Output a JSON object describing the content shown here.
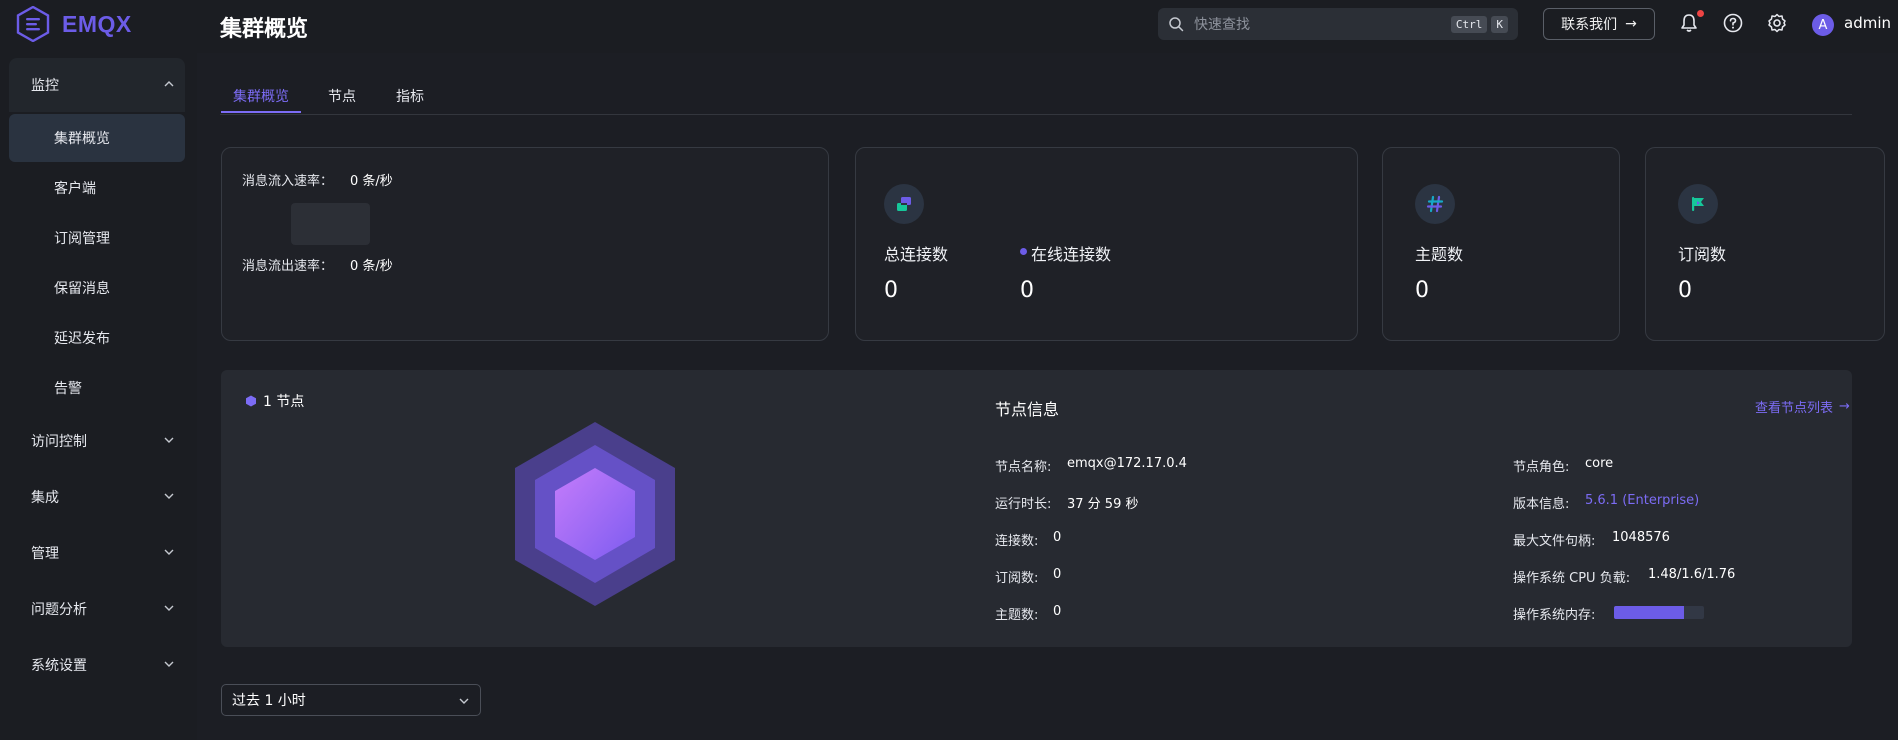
{
  "app": {
    "logo_text": "EMQX",
    "page_title": "集群概览"
  },
  "header": {
    "search_placeholder": "快速查找",
    "kbd_ctrl": "Ctrl",
    "kbd_k": "K",
    "contact_label": "联系我们",
    "username": "admin",
    "avatar_letter": "A"
  },
  "sidebar": {
    "groups": [
      {
        "label": "监控",
        "expanded": true
      },
      {
        "label": "访问控制",
        "expanded": false
      },
      {
        "label": "集成",
        "expanded": false
      },
      {
        "label": "管理",
        "expanded": false
      },
      {
        "label": "问题分析",
        "expanded": false
      },
      {
        "label": "系统设置",
        "expanded": false
      }
    ],
    "monitor_items": [
      {
        "label": "集群概览",
        "active": true
      },
      {
        "label": "客户端",
        "active": false
      },
      {
        "label": "订阅管理",
        "active": false
      },
      {
        "label": "保留消息",
        "active": false
      },
      {
        "label": "延迟发布",
        "active": false
      },
      {
        "label": "告警",
        "active": false
      }
    ]
  },
  "tabs": [
    {
      "label": "集群概览",
      "active": true
    },
    {
      "label": "节点",
      "active": false
    },
    {
      "label": "指标",
      "active": false
    }
  ],
  "rates": {
    "in_label": "消息流入速率：",
    "in_value": "0 条/秒",
    "out_label": "消息流出速率：",
    "out_value": "0 条/秒"
  },
  "stats": {
    "total_connections": {
      "label": "总连接数",
      "value": "0"
    },
    "online_connections": {
      "label": "在线连接数",
      "value": "0"
    },
    "topics": {
      "label": "主题数",
      "value": "0"
    },
    "subscriptions": {
      "label": "订阅数",
      "value": "0"
    }
  },
  "nodes": {
    "count_label": "1 节点",
    "info_title": "节点信息",
    "view_list": "查看节点列表",
    "left": [
      {
        "key": "节点名称:",
        "value": "emqx@172.17.0.4"
      },
      {
        "key": "运行时长:",
        "value": "37 分 59 秒"
      },
      {
        "key": "连接数:",
        "value": "0"
      },
      {
        "key": "订阅数:",
        "value": "0"
      },
      {
        "key": "主题数:",
        "value": "0"
      }
    ],
    "right": [
      {
        "key": "节点角色:",
        "value": "core"
      },
      {
        "key": "版本信息:",
        "value": "5.6.1 (Enterprise)"
      },
      {
        "key": "最大文件句柄:",
        "value": "1048576"
      },
      {
        "key": "操作系统 CPU 负载:",
        "value": "1.48/1.6/1.76"
      },
      {
        "key": "操作系统内存:",
        "value": ""
      }
    ],
    "memory_usage_fraction": 0.78
  },
  "time_range": {
    "selected": "过去 1 小时"
  },
  "colors": {
    "accent": "#6c5ce7",
    "link": "#7c6cf5",
    "alert_dot": "#ef4444"
  }
}
